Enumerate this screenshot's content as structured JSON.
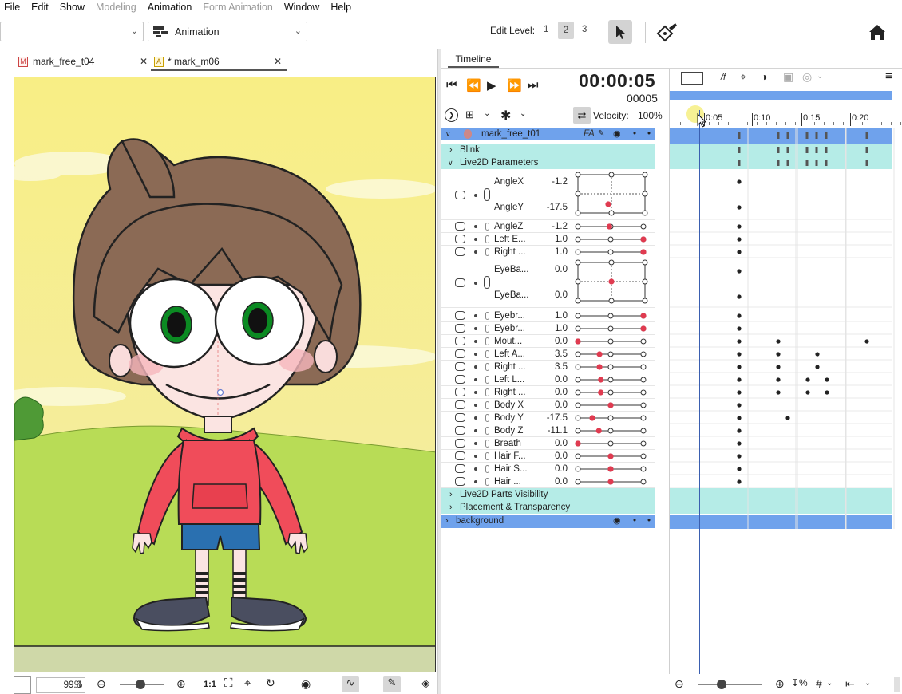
{
  "menu": {
    "items": [
      {
        "label": "File",
        "disabled": false
      },
      {
        "label": "Edit",
        "disabled": false
      },
      {
        "label": "Show",
        "disabled": false
      },
      {
        "label": "Modeling",
        "disabled": true
      },
      {
        "label": "Animation",
        "disabled": false
      },
      {
        "label": "Form Animation",
        "disabled": true
      },
      {
        "label": "Window",
        "disabled": false
      },
      {
        "label": "Help",
        "disabled": false
      }
    ]
  },
  "toolbar": {
    "workspace_select": "Animation",
    "edit_level_label": "Edit Level:",
    "edit_levels": [
      "1",
      "2",
      "3"
    ],
    "edit_level_selected": "2"
  },
  "tabs": [
    {
      "label": "mark_free_t04",
      "icon": "model-file-icon",
      "active": false
    },
    {
      "label": "* mark_m06",
      "icon": "animation-file-icon",
      "active": true
    }
  ],
  "view_bottom": {
    "zoom": "99.0",
    "zoom_unit": "%",
    "scale_label": "1:1"
  },
  "timeline": {
    "tab_label": "Timeline",
    "time": "00:00:05",
    "frame": "00005",
    "velocity_label": "Velocity:",
    "velocity_value": "100%",
    "per_frame_label": "/f",
    "ruler_ticks": [
      "0:05",
      "0:10",
      "0:15",
      "0:20"
    ],
    "track_root": "mark_free_t01",
    "track_root_badge": "FA",
    "groups": {
      "blink": "Blink",
      "params": "Live2D Parameters",
      "parts": "Live2D Parts Visibility",
      "placement": "Placement & Transparency",
      "background": "background"
    },
    "params_2d": [
      {
        "name_a": "AngleX",
        "val_a": "-1.2",
        "name_b": "AngleY",
        "val_b": "-17.5",
        "dot_pos": "(0,-17.5)"
      },
      {
        "name_a": "EyeBa...",
        "val_a": "0.0",
        "name_b": "EyeBa...",
        "val_b": "0.0",
        "dot_pos": "(0,0)"
      }
    ],
    "params": [
      {
        "name": "AngleZ",
        "value": "-1.2",
        "pos": 0.48
      },
      {
        "name": "Left E...",
        "value": "1.0",
        "pos": 1.0
      },
      {
        "name": "Right ...",
        "value": "1.0",
        "pos": 1.0
      },
      {
        "name": "Eyebr...",
        "value": "1.0",
        "pos": 1.0
      },
      {
        "name": "Eyebr...",
        "value": "1.0",
        "pos": 1.0
      },
      {
        "name": "Mout...",
        "value": "0.0",
        "pos": 0.0
      },
      {
        "name": "Left A...",
        "value": "3.5",
        "pos": 0.33
      },
      {
        "name": "Right ...",
        "value": "3.5",
        "pos": 0.33
      },
      {
        "name": "Left L...",
        "value": "0.0",
        "pos": 0.35
      },
      {
        "name": "Right ...",
        "value": "0.0",
        "pos": 0.35
      },
      {
        "name": "Body X",
        "value": "0.0",
        "pos": 0.5
      },
      {
        "name": "Body Y",
        "value": "-17.5",
        "pos": 0.22
      },
      {
        "name": "Body Z",
        "value": "-11.1",
        "pos": 0.32
      },
      {
        "name": "Breath",
        "value": "0.0",
        "pos": 0.0
      },
      {
        "name": "Hair F...",
        "value": "0.0",
        "pos": 0.5
      },
      {
        "name": "Hair S...",
        "value": "0.0",
        "pos": 0.5
      },
      {
        "name": "Hair ...",
        "value": "0.0",
        "pos": 0.5
      }
    ]
  }
}
